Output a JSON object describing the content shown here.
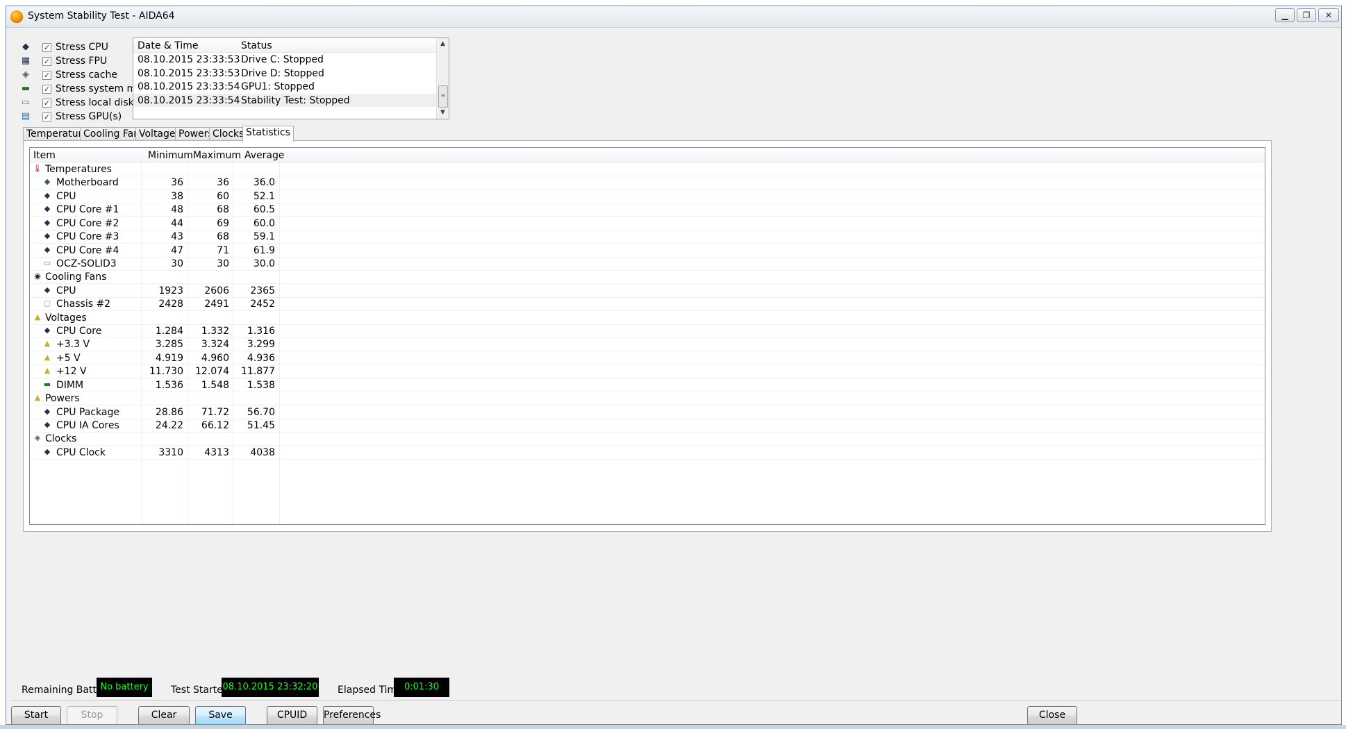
{
  "window": {
    "title": "System Stability Test - AIDA64"
  },
  "stress_options": [
    {
      "icon": "cpu-icon",
      "label": "Stress CPU",
      "checked": true
    },
    {
      "icon": "fpu-icon",
      "label": "Stress FPU",
      "checked": true
    },
    {
      "icon": "cache-icon",
      "label": "Stress cache",
      "checked": true
    },
    {
      "icon": "memory-icon",
      "label": "Stress system memory",
      "checked": true
    },
    {
      "icon": "disk-icon",
      "label": "Stress local disks",
      "checked": true
    },
    {
      "icon": "gpu-icon",
      "label": "Stress GPU(s)",
      "checked": true
    }
  ],
  "log": {
    "headers": {
      "datetime": "Date & Time",
      "status": "Status"
    },
    "rows": [
      {
        "datetime": "08.10.2015 23:33:53",
        "status": "Drive C: Stopped"
      },
      {
        "datetime": "08.10.2015 23:33:53",
        "status": "Drive D: Stopped"
      },
      {
        "datetime": "08.10.2015 23:33:54",
        "status": "GPU1: Stopped"
      },
      {
        "datetime": "08.10.2015 23:33:54",
        "status": "Stability Test: Stopped"
      }
    ]
  },
  "tabs": [
    {
      "label": "Temperatures",
      "active": false
    },
    {
      "label": "Cooling Fans",
      "active": false
    },
    {
      "label": "Voltages",
      "active": false
    },
    {
      "label": "Powers",
      "active": false
    },
    {
      "label": "Clocks",
      "active": false
    },
    {
      "label": "Statistics",
      "active": true
    }
  ],
  "stats": {
    "headers": {
      "item": "Item",
      "min": "Minimum",
      "max": "Maximum",
      "avg": "Average"
    },
    "rows": [
      {
        "group": true,
        "icon": "thermometer-icon",
        "item": "Temperatures"
      },
      {
        "icon": "motherboard-icon",
        "item": "Motherboard",
        "min": "36",
        "max": "36",
        "avg": "36.0"
      },
      {
        "icon": "cpu-icon",
        "item": "CPU",
        "min": "38",
        "max": "60",
        "avg": "52.1"
      },
      {
        "icon": "cpu-icon",
        "item": "CPU Core #1",
        "min": "48",
        "max": "68",
        "avg": "60.5"
      },
      {
        "icon": "cpu-icon",
        "item": "CPU Core #2",
        "min": "44",
        "max": "69",
        "avg": "60.0"
      },
      {
        "icon": "cpu-icon",
        "item": "CPU Core #3",
        "min": "43",
        "max": "68",
        "avg": "59.1"
      },
      {
        "icon": "cpu-icon",
        "item": "CPU Core #4",
        "min": "47",
        "max": "71",
        "avg": "61.9"
      },
      {
        "icon": "disk-icon",
        "item": "OCZ-SOLID3",
        "min": "30",
        "max": "30",
        "avg": "30.0"
      },
      {
        "group": true,
        "icon": "fan-icon",
        "item": "Cooling Fans"
      },
      {
        "icon": "cpu-icon",
        "item": "CPU",
        "min": "1923",
        "max": "2606",
        "avg": "2365"
      },
      {
        "icon": "chassis-icon",
        "item": "Chassis #2",
        "min": "2428",
        "max": "2491",
        "avg": "2452"
      },
      {
        "group": true,
        "icon": "voltage-icon",
        "item": "Voltages"
      },
      {
        "icon": "cpu-icon",
        "item": "CPU Core",
        "min": "1.284",
        "max": "1.332",
        "avg": "1.316"
      },
      {
        "icon": "voltage-icon",
        "item": "+3.3 V",
        "min": "3.285",
        "max": "3.324",
        "avg": "3.299"
      },
      {
        "icon": "voltage-icon",
        "item": "+5 V",
        "min": "4.919",
        "max": "4.960",
        "avg": "4.936"
      },
      {
        "icon": "voltage-icon",
        "item": "+12 V",
        "min": "11.730",
        "max": "12.074",
        "avg": "11.877"
      },
      {
        "icon": "memory-icon",
        "item": "DIMM",
        "min": "1.536",
        "max": "1.548",
        "avg": "1.538"
      },
      {
        "group": true,
        "icon": "voltage-icon",
        "item": "Powers"
      },
      {
        "icon": "cpu-icon",
        "item": "CPU Package",
        "min": "28.86",
        "max": "71.72",
        "avg": "56.70"
      },
      {
        "icon": "cpu-icon",
        "item": "CPU IA Cores",
        "min": "24.22",
        "max": "66.12",
        "avg": "51.45"
      },
      {
        "group": true,
        "icon": "clock-icon",
        "item": "Clocks"
      },
      {
        "icon": "cpu-icon",
        "item": "CPU Clock",
        "min": "3310",
        "max": "4313",
        "avg": "4038"
      }
    ]
  },
  "status": {
    "battery_label": "Remaining Battery:",
    "battery_value": "No battery",
    "started_label": "Test Started:",
    "started_value": "08.10.2015 23:32:20",
    "elapsed_label": "Elapsed Time:",
    "elapsed_value": "0:01:30"
  },
  "buttons": {
    "start": "Start",
    "stop": "Stop",
    "clear": "Clear",
    "save": "Save",
    "cpuid": "CPUID",
    "preferences": "Preferences",
    "close": "Close"
  },
  "colors": {
    "status_text": "#19ff19",
    "status_bg": "#000000",
    "selection": "#cce8ff"
  }
}
